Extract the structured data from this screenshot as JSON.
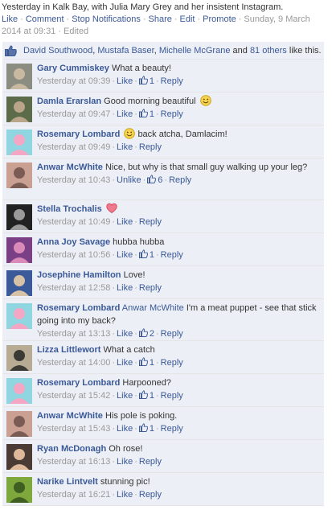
{
  "post": {
    "text": "Yesterday in Kalk Bay, with Julia Mary Grey and her insistent Instagram.",
    "actions": [
      "Like",
      "Comment",
      "Stop Notifications",
      "Share",
      "Edit",
      "Promote"
    ],
    "timestamp_line1": "Sunday, 9 March 2014",
    "timestamp_line2": "at 09:31",
    "edited": "Edited"
  },
  "likes": {
    "names": [
      "David Southwood",
      "Mustafa Baser",
      "Michelle McGrane"
    ],
    "and": "and",
    "others": "81 others",
    "suffix": "like this."
  },
  "comments": [
    {
      "author": "Gary Cummiskey",
      "text": "What a beauty!",
      "time": "Yesterday at 09:39",
      "like_label": "Like",
      "likes": "1",
      "reply": "Reply",
      "avatar_icon": "avatar-man-grey",
      "avatar_colors": [
        "#8a8d80",
        "#c9b9a0"
      ]
    },
    {
      "author": "Damla Erarslan",
      "text": "Good morning beautiful",
      "emoji": "smile",
      "time": "Yesterday at 09:47",
      "like_label": "Like",
      "likes": "1",
      "reply": "Reply",
      "avatar_icon": "avatar-man-cap",
      "avatar_colors": [
        "#5c6b4a",
        "#b9a68a"
      ]
    },
    {
      "author": "Rosemary Lombard",
      "text": "back atcha, Damlacim!",
      "emoji_before": "smile",
      "time": "Yesterday at 09:49",
      "like_label": "Like",
      "likes": "",
      "reply": "Reply",
      "avatar_icon": "avatar-cartoon",
      "avatar_colors": [
        "#8fd6e0",
        "#f3a7c5"
      ]
    },
    {
      "author": "Anwar McWhite",
      "text": "Nice, but why is that small guy walking up your leg?",
      "time": "Yesterday at 10:43",
      "like_label": "Unlike",
      "likes": "6",
      "reply": "Reply",
      "avatar_icon": "avatar-man-pink",
      "avatar_colors": [
        "#c9a092",
        "#7a5c55"
      ]
    },
    {
      "author": "Stella Trochalis",
      "text": "",
      "emoji": "heart",
      "time": "Yesterday at 10:49",
      "like_label": "Like",
      "likes": "",
      "reply": "Reply",
      "avatar_icon": "avatar-bw",
      "avatar_colors": [
        "#222222",
        "#9a9a9a"
      ]
    },
    {
      "author": "Anna Joy Savage",
      "text": "hubba hubba",
      "time": "Yesterday at 10:56",
      "like_label": "Like",
      "likes": "1",
      "reply": "Reply",
      "avatar_icon": "avatar-woman-purple",
      "avatar_colors": [
        "#7b3f86",
        "#d98ab8"
      ]
    },
    {
      "author": "Josephine Hamilton",
      "text": "Love!",
      "time": "Yesterday at 12:58",
      "like_label": "Like",
      "likes": "",
      "reply": "Reply",
      "avatar_icon": "avatar-woman-blue",
      "avatar_colors": [
        "#3b5a9a",
        "#d8c2a5"
      ]
    },
    {
      "author": "Rosemary Lombard",
      "reply_to": "Anwar McWhite",
      "text": "I'm a meat puppet - see that stick going into my back?",
      "time": "Yesterday at 13:13",
      "like_label": "Like",
      "likes": "2",
      "reply": "Reply",
      "avatar_icon": "avatar-cartoon",
      "avatar_colors": [
        "#8fd6e0",
        "#f3a7c5"
      ]
    },
    {
      "author": "Lizza Littlewort",
      "text": "What a catch",
      "time": "Yesterday at 14:00",
      "like_label": "Like",
      "likes": "1",
      "reply": "Reply",
      "avatar_icon": "avatar-dog",
      "avatar_colors": [
        "#b7ab93",
        "#3b3a35"
      ]
    },
    {
      "author": "Rosemary Lombard",
      "text": "Harpooned?",
      "time": "Yesterday at 15:42",
      "like_label": "Like",
      "likes": "1",
      "reply": "Reply",
      "avatar_icon": "avatar-cartoon",
      "avatar_colors": [
        "#8fd6e0",
        "#f3a7c5"
      ]
    },
    {
      "author": "Anwar McWhite",
      "text": "His pole is poking.",
      "time": "Yesterday at 15:43",
      "like_label": "Like",
      "likes": "1",
      "reply": "Reply",
      "avatar_icon": "avatar-man-pink",
      "avatar_colors": [
        "#c9a092",
        "#7a5c55"
      ]
    },
    {
      "author": "Ryan McDonagh",
      "text": "Oh rose!",
      "time": "Yesterday at 16:13",
      "like_label": "Like",
      "likes": "",
      "reply": "Reply",
      "avatar_icon": "avatar-couple",
      "avatar_colors": [
        "#4a3b35",
        "#e0b89a"
      ]
    },
    {
      "author": "Narike Lintvelt",
      "text": "stunning pic!",
      "time": "Yesterday at 16:21",
      "like_label": "Like",
      "likes": "",
      "reply": "Reply",
      "avatar_icon": "avatar-green",
      "avatar_colors": [
        "#7ea83c",
        "#3f5f22"
      ]
    }
  ]
}
